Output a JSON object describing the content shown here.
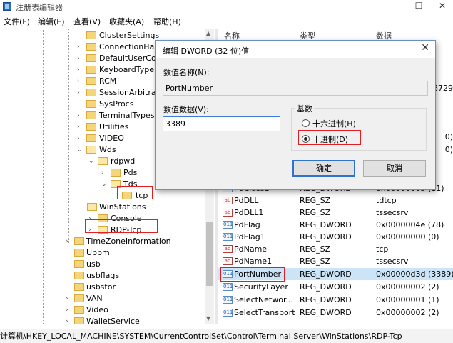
{
  "window": {
    "title": "注册表编辑器",
    "minimize_glyph": "—",
    "maximize_glyph": "☐",
    "close_glyph": "✕"
  },
  "menu": [
    "文件(F)",
    "编辑(E)",
    "查看(V)",
    "收藏夹(A)",
    "帮助(H)"
  ],
  "tree": {
    "items": [
      {
        "label": "ClusterSettings",
        "chev": ""
      },
      {
        "label": "ConnectionHar",
        "chev": "›"
      },
      {
        "label": "DefaultUserCor",
        "chev": "›"
      },
      {
        "label": "KeyboardType",
        "chev": "›"
      },
      {
        "label": "RCM",
        "chev": "›"
      },
      {
        "label": "SessionArbitra",
        "chev": "›"
      },
      {
        "label": "SysProcs",
        "chev": ""
      },
      {
        "label": "TerminalTypes",
        "chev": "›"
      },
      {
        "label": "Utilities",
        "chev": "›"
      },
      {
        "label": "VIDEO",
        "chev": "›"
      },
      {
        "label": "Wds",
        "chev": "⌄"
      },
      {
        "label": "rdpwd",
        "chev": "⌄"
      },
      {
        "label": "Pds",
        "chev": "›"
      },
      {
        "label": "Tds",
        "chev": "⌄"
      },
      {
        "label": "tcp",
        "chev": ""
      },
      {
        "label": "WinStations",
        "chev": "⌄"
      },
      {
        "label": "Console",
        "chev": "›"
      },
      {
        "label": "RDP-Tcp",
        "chev": "›"
      },
      {
        "label": "TimeZoneInformation",
        "chev": "›"
      },
      {
        "label": "Ubpm",
        "chev": ""
      },
      {
        "label": "usb",
        "chev": ""
      },
      {
        "label": "usbflags",
        "chev": ""
      },
      {
        "label": "usbstor",
        "chev": ""
      },
      {
        "label": "VAN",
        "chev": "›"
      },
      {
        "label": "Video",
        "chev": "›"
      },
      {
        "label": "WalletService",
        "chev": "›"
      }
    ]
  },
  "values": {
    "headers": [
      "名称",
      "类型",
      "数据"
    ],
    "partial_right": [
      "6729",
      "0)",
      "0)"
    ],
    "rows": [
      {
        "name": "PdClass1",
        "type": "REG_DWORD",
        "data": "0x0000000b (11)",
        "kind": "dw"
      },
      {
        "name": "PdDLL",
        "type": "REG_SZ",
        "data": "tdtcp",
        "kind": "sz"
      },
      {
        "name": "PdDLL1",
        "type": "REG_SZ",
        "data": "tssecsrv",
        "kind": "sz"
      },
      {
        "name": "PdFlag",
        "type": "REG_DWORD",
        "data": "0x0000004e (78)",
        "kind": "dw"
      },
      {
        "name": "PdFlag1",
        "type": "REG_DWORD",
        "data": "0x00000000 (0)",
        "kind": "dw"
      },
      {
        "name": "PdName",
        "type": "REG_SZ",
        "data": "tcp",
        "kind": "sz"
      },
      {
        "name": "PdName1",
        "type": "REG_SZ",
        "data": "tssecsrv",
        "kind": "sz"
      },
      {
        "name": "PortNumber",
        "type": "REG_DWORD",
        "data": "0x00000d3d (3389)",
        "kind": "dw"
      },
      {
        "name": "SecurityLayer",
        "type": "REG_DWORD",
        "data": "0x00000002 (2)",
        "kind": "dw"
      },
      {
        "name": "SelectNetwor...",
        "type": "REG_DWORD",
        "data": "0x00000001 (1)",
        "kind": "dw"
      },
      {
        "name": "SelectTransport",
        "type": "REG_DWORD",
        "data": "0x00000002 (2)",
        "kind": "dw"
      }
    ]
  },
  "status": {
    "path": "计算机\\HKEY_LOCAL_MACHINE\\SYSTEM\\CurrentControlSet\\Control\\Terminal Server\\WinStations\\RDP-Tcp"
  },
  "dialog": {
    "title": "编辑 DWORD (32 位)值",
    "close_glyph": "✕",
    "name_label": "数值名称(N):",
    "name_value": "PortNumber",
    "data_label": "数值数据(V):",
    "data_value": "3389",
    "base_label": "基数",
    "hex_label": "十六进制(H)",
    "dec_label": "十进制(D)",
    "selected_base": "dec",
    "ok_label": "确定",
    "cancel_label": "取消"
  }
}
